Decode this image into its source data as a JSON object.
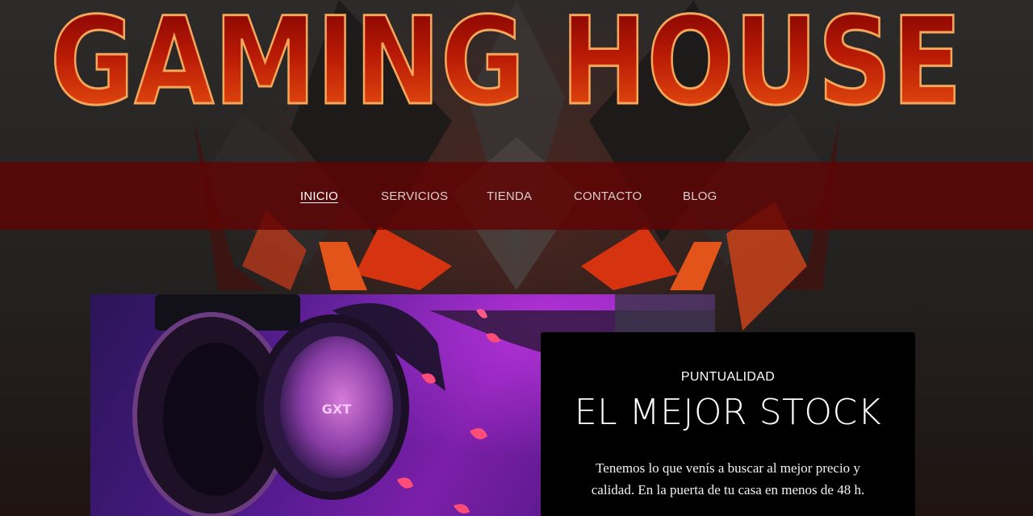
{
  "site": {
    "logo_text": "GAMING HOUSE",
    "brand_colors": {
      "logo_top": "#f25a12",
      "logo_bottom": "#7a0000",
      "nav_bar": "#600404",
      "card_bg": "#000000"
    }
  },
  "nav": {
    "items": [
      {
        "label": "INICIO",
        "active": true
      },
      {
        "label": "SERVICIOS",
        "active": false
      },
      {
        "label": "TIENDA",
        "active": false
      },
      {
        "label": "CONTACTO",
        "active": false
      },
      {
        "label": "BLOG",
        "active": false
      }
    ]
  },
  "hero": {
    "image_label": "gaming-headset-photo",
    "headset_brand": "GXT",
    "card": {
      "eyebrow": "PUNTUALIDAD",
      "title": "EL MEJOR STOCK",
      "text": "Tenemos lo que venís a buscar al mejor precio y calidad. En la puerta de tu casa en menos de 48 h."
    }
  }
}
